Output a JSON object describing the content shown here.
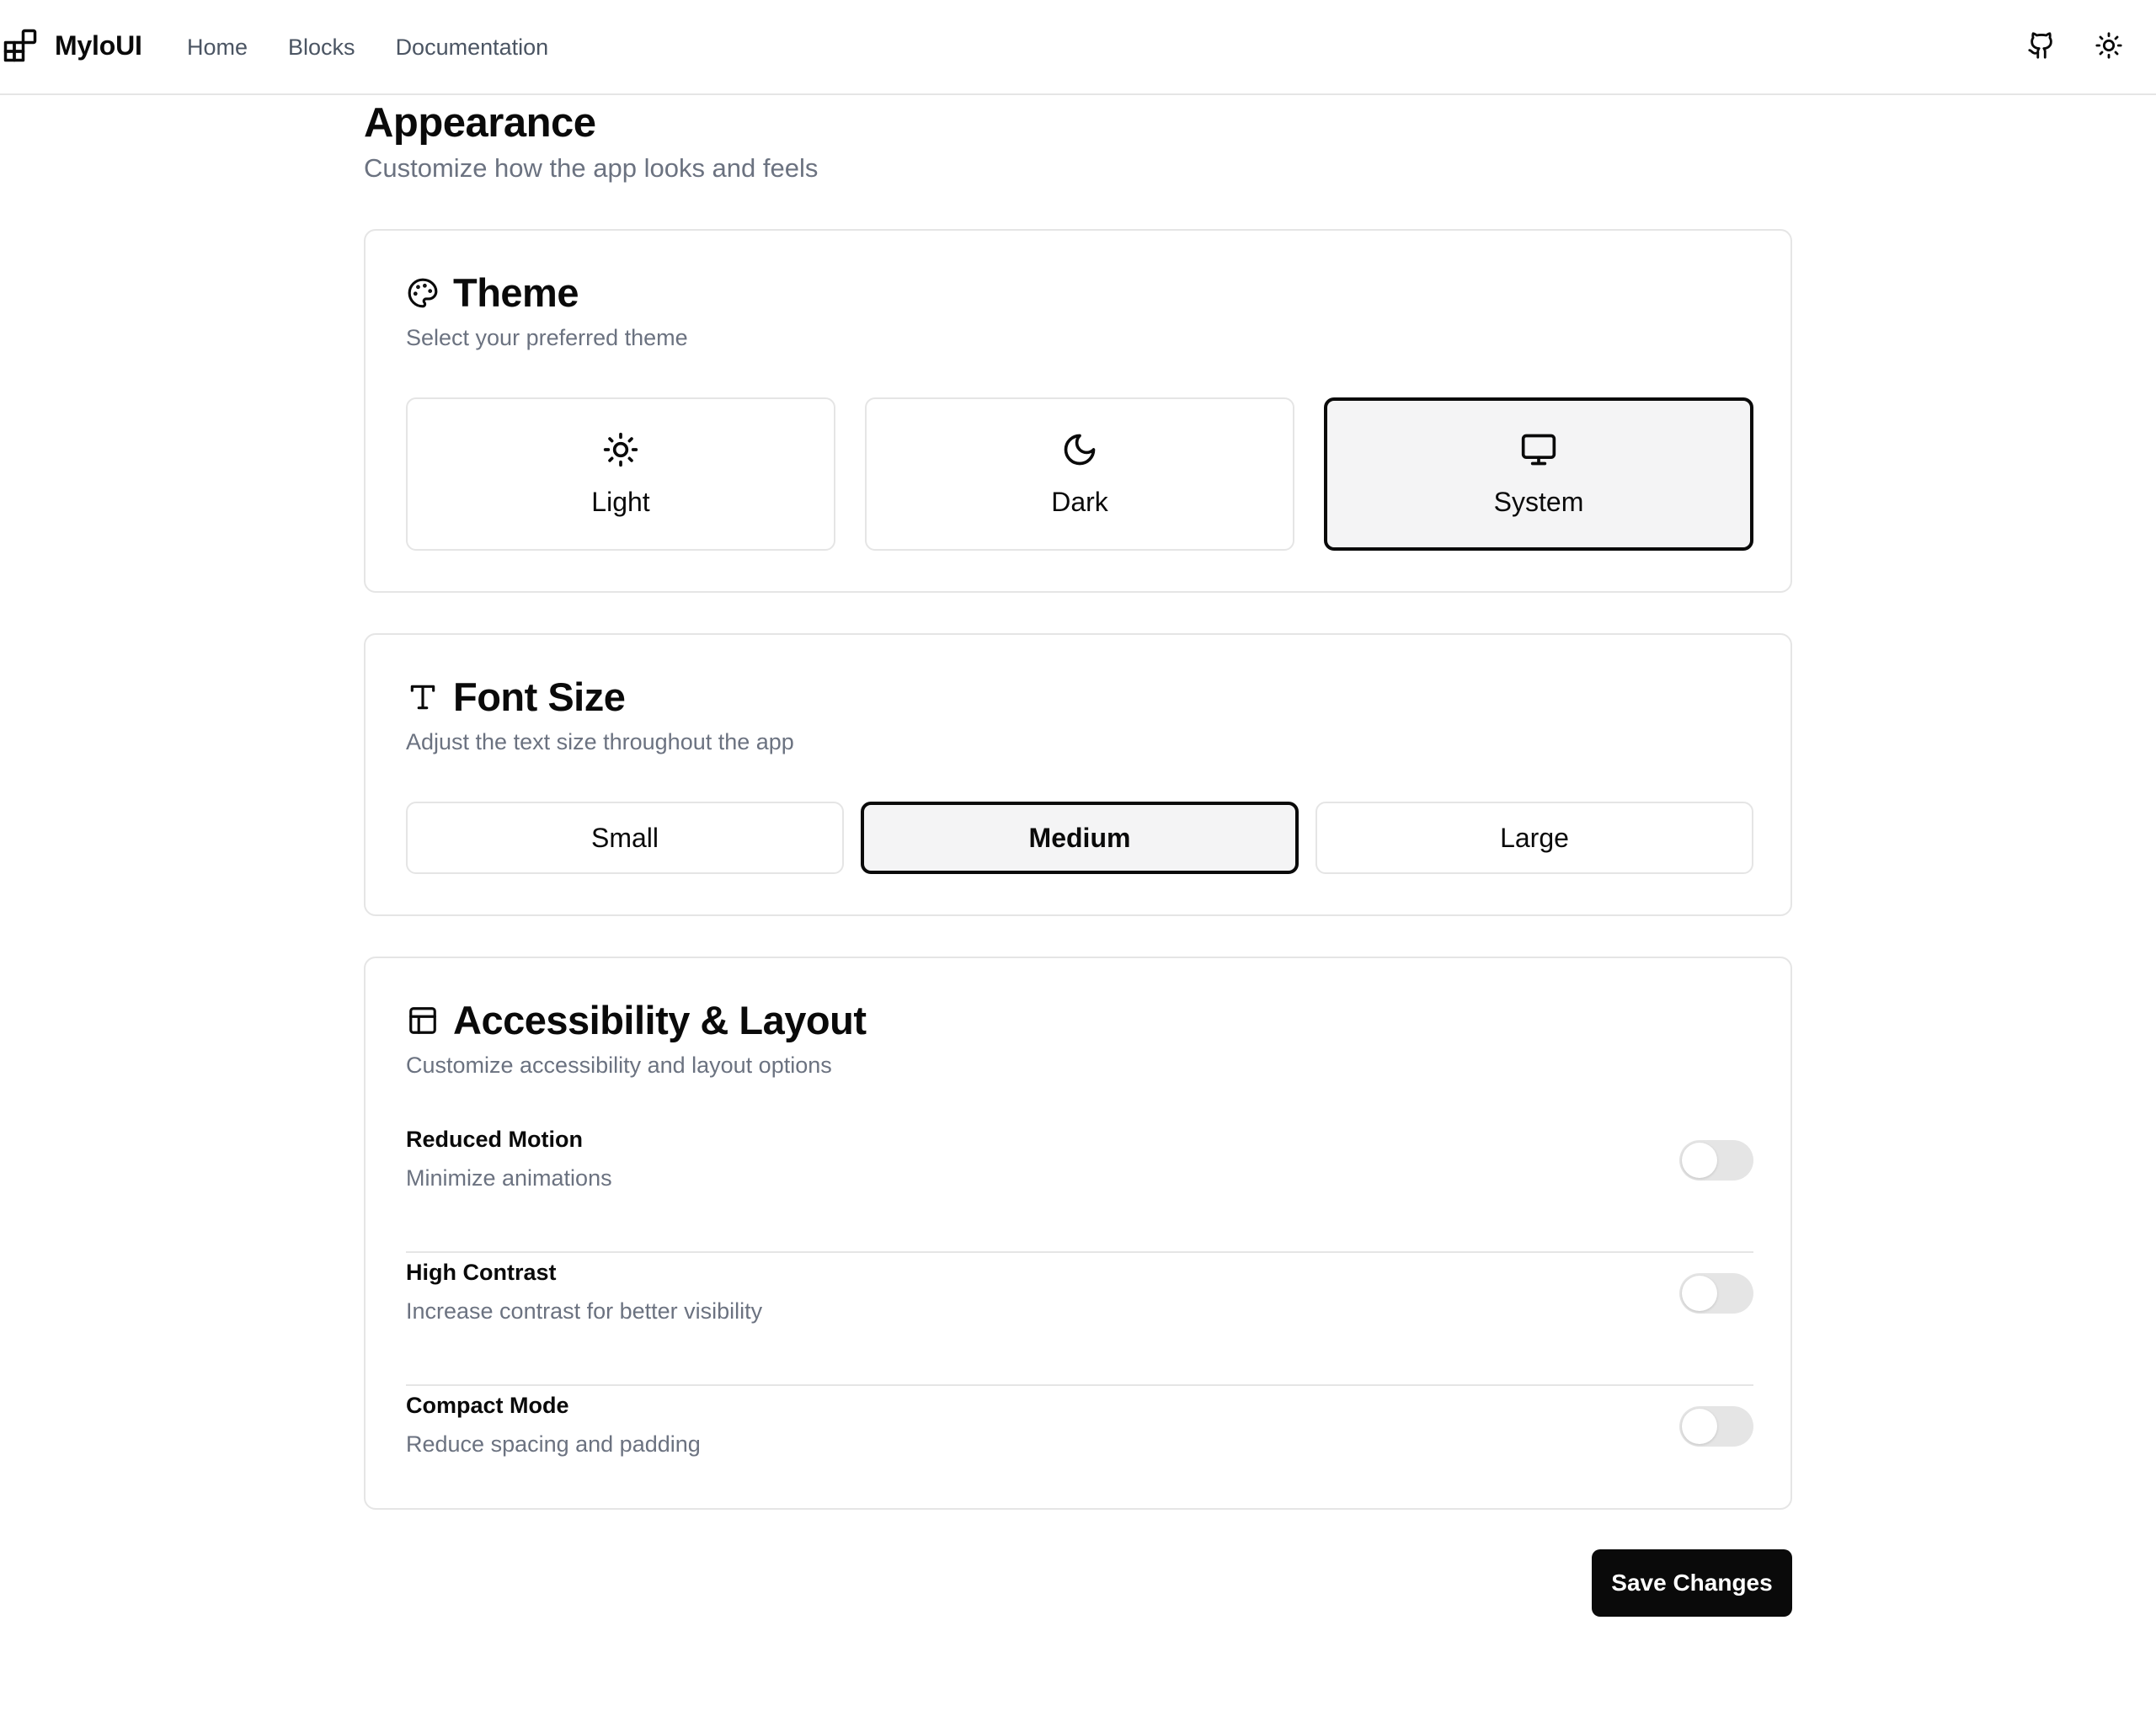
{
  "header": {
    "brand_name": "MyloUI",
    "brand_icon": "blocks-icon",
    "nav": [
      "Home",
      "Blocks",
      "Documentation"
    ],
    "actions": [
      "github-icon",
      "sun-icon"
    ]
  },
  "page": {
    "title": "Appearance",
    "subtitle": "Customize how the app looks and feels"
  },
  "theme": {
    "title": "Theme",
    "icon": "palette-icon",
    "description": "Select your preferred theme",
    "selected": "System",
    "options": [
      {
        "label": "Light",
        "icon": "sun-icon"
      },
      {
        "label": "Dark",
        "icon": "moon-icon"
      },
      {
        "label": "System",
        "icon": "monitor-icon"
      }
    ]
  },
  "font_size": {
    "title": "Font Size",
    "icon": "type-icon",
    "description": "Adjust the text size throughout the app",
    "selected": "Medium",
    "options": [
      "Small",
      "Medium",
      "Large"
    ]
  },
  "accessibility": {
    "title": "Accessibility & Layout",
    "icon": "layout-icon",
    "description": "Customize accessibility and layout options",
    "settings": [
      {
        "title": "Reduced Motion",
        "description": "Minimize animations",
        "enabled": false
      },
      {
        "title": "High Contrast",
        "description": "Increase contrast for better visibility",
        "enabled": false
      },
      {
        "title": "Compact Mode",
        "description": "Reduce spacing and padding",
        "enabled": false
      }
    ]
  },
  "save_label": "Save Changes",
  "colors": {
    "accent": "#0a0a0a",
    "border": "#e5e5e5",
    "muted_text": "#6b7280",
    "selected_bg": "#f4f4f5"
  }
}
